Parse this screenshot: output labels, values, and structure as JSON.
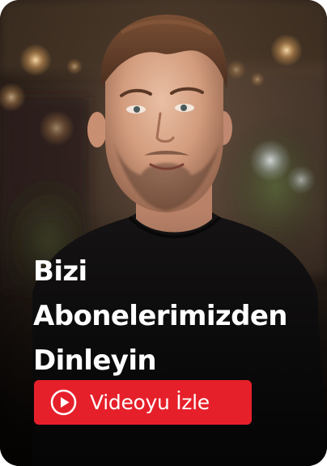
{
  "hero": {
    "headline_lines": [
      "Bizi",
      "Abonelerimizden",
      "Dinleyin"
    ],
    "button_label": "Videoyu İzle",
    "button_icon": "play-circle-icon",
    "image_subject": "smiling man with short brown hair and beard, black t-shirt, blurred bokeh background",
    "colors": {
      "accent": "#e6202a",
      "text": "#ffffff"
    }
  }
}
